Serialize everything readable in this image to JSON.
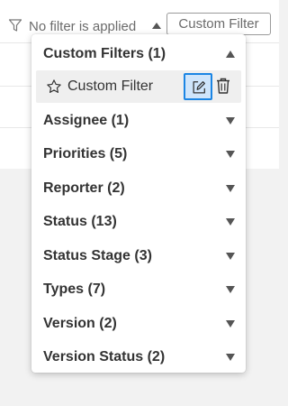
{
  "toolbar": {
    "filter_status": "No filter is applied",
    "custom_filter_button": "Custom Filter"
  },
  "dropdown": {
    "custom_filters": {
      "label": "Custom Filters (1)",
      "expanded": true,
      "items": [
        {
          "label": "Custom Filter",
          "icon": "star-outline-icon",
          "actions": [
            "edit-icon",
            "trash-icon"
          ]
        }
      ]
    },
    "groups": [
      {
        "label": "Assignee (1)"
      },
      {
        "label": "Priorities (5)"
      },
      {
        "label": "Reporter (2)"
      },
      {
        "label": "Status (13)"
      },
      {
        "label": "Status Stage (3)"
      },
      {
        "label": "Types (7)"
      },
      {
        "label": "Version (2)"
      },
      {
        "label": "Version Status (2)"
      }
    ]
  },
  "colors": {
    "accent": "#1b85e4",
    "accent_bg": "#cfe5fb",
    "selected_item_bg": "#efefef"
  }
}
